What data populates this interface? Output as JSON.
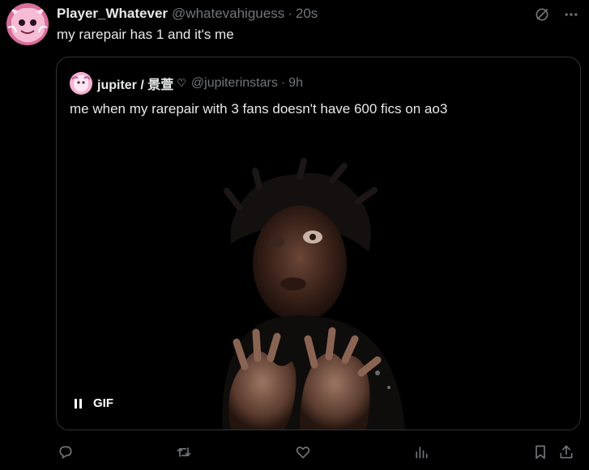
{
  "tweet": {
    "display_name": "Player_Whatever",
    "handle": "@whatevahiguess",
    "separator": "·",
    "time": "20s",
    "text": "my rarepair has 1 and it's me",
    "avatar_icon": "profile-avatar"
  },
  "top_actions": {
    "grok_icon": "grok-icon",
    "more_icon": "more-icon"
  },
  "quote": {
    "display_name": "jupiter / 景萱",
    "badge": "♡",
    "handle": "@jupiterinstars",
    "separator": "·",
    "time": "9h",
    "text": "me when my rarepair with 3 fans doesn't have 600 fics on ao3",
    "media": {
      "type": "GIF",
      "badge_label": "GIF",
      "pause_icon": "pause-icon"
    }
  },
  "actions": {
    "reply_icon": "reply-icon",
    "retweet_icon": "retweet-icon",
    "like_icon": "heart-icon",
    "views_icon": "views-icon",
    "bookmark_icon": "bookmark-icon",
    "share_icon": "share-icon"
  },
  "colors": {
    "background": "#000000",
    "primary_text": "#e7e9ea",
    "secondary_text": "#71767b",
    "border": "#2f3336"
  }
}
